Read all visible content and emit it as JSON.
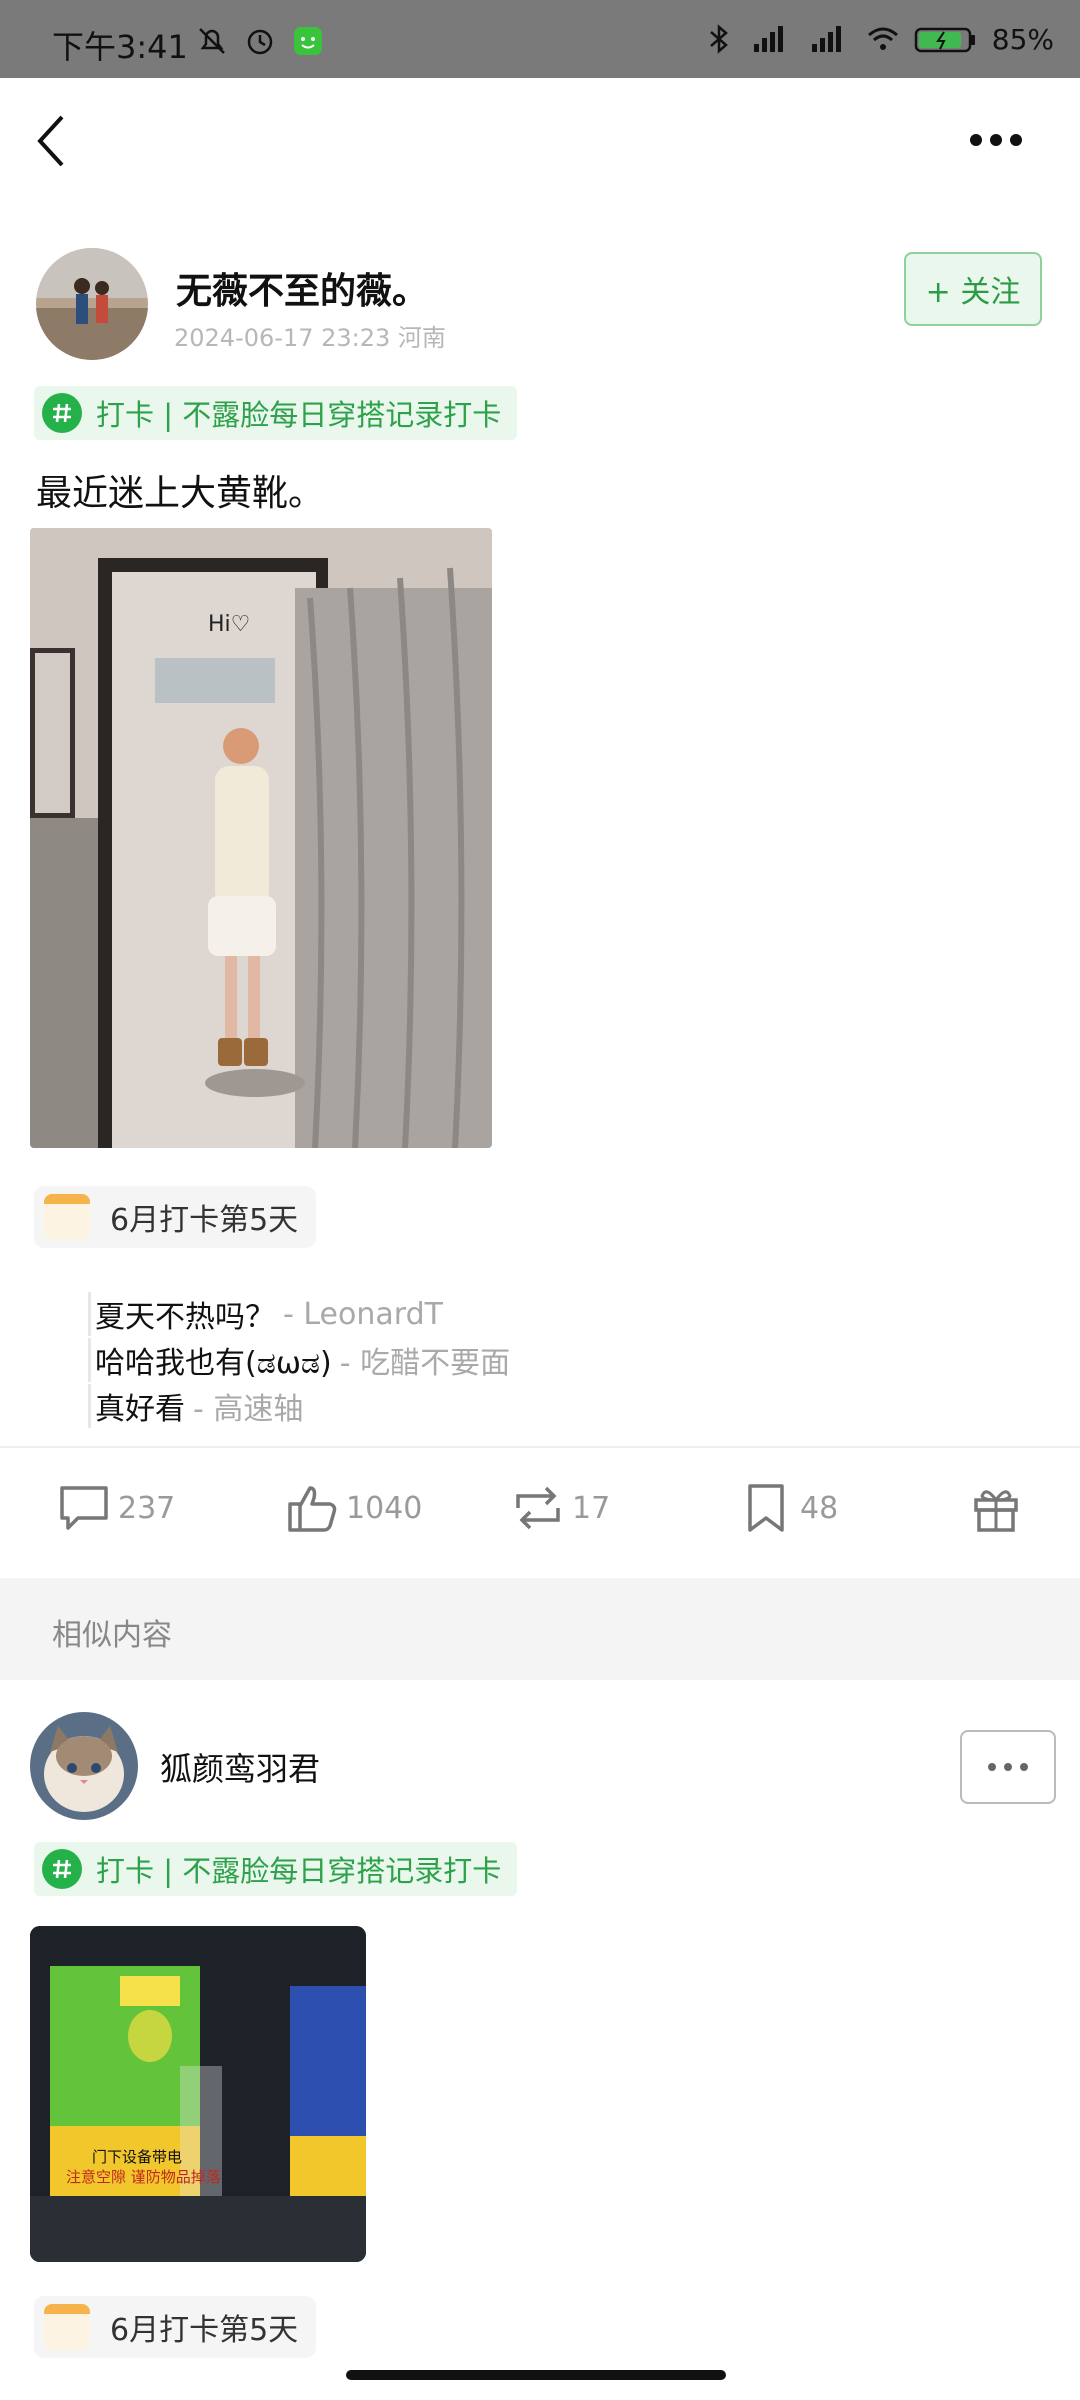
{
  "status_bar": {
    "time": "下午3:41",
    "battery": "85%"
  },
  "post1": {
    "author": "无薇不至的薇。",
    "meta": "2024-06-17 23:23 河南",
    "follow_label": "+ 关注",
    "topic": "打卡 | 不露脸每日穿搭记录打卡",
    "text": "最近迷上大黄靴。",
    "photo_caption": "Hi♡",
    "checkin": "6月打卡第5天",
    "comments": [
      {
        "text": "夏天不热吗？",
        "author": " - LeonardT"
      },
      {
        "text": "哈哈我也有(ಡωಡ)",
        "author": " - 吃醋不要面"
      },
      {
        "text": "真好看",
        "author": " - 高速轴"
      }
    ],
    "actions": {
      "comments": "237",
      "likes": "1040",
      "reposts": "17",
      "favorites": "48"
    }
  },
  "similar_title": "相似内容",
  "post2": {
    "author": "狐颜鸾羽君",
    "topic": "打卡 | 不露脸每日穿搭记录打卡",
    "checkin": "6月打卡第5天",
    "sign1": "门下设备带电",
    "sign2": "注意空隙 谨防物品掉落"
  },
  "colors": {
    "accent_green": "#2ea14c",
    "status_bar": "#7a7a7a"
  }
}
